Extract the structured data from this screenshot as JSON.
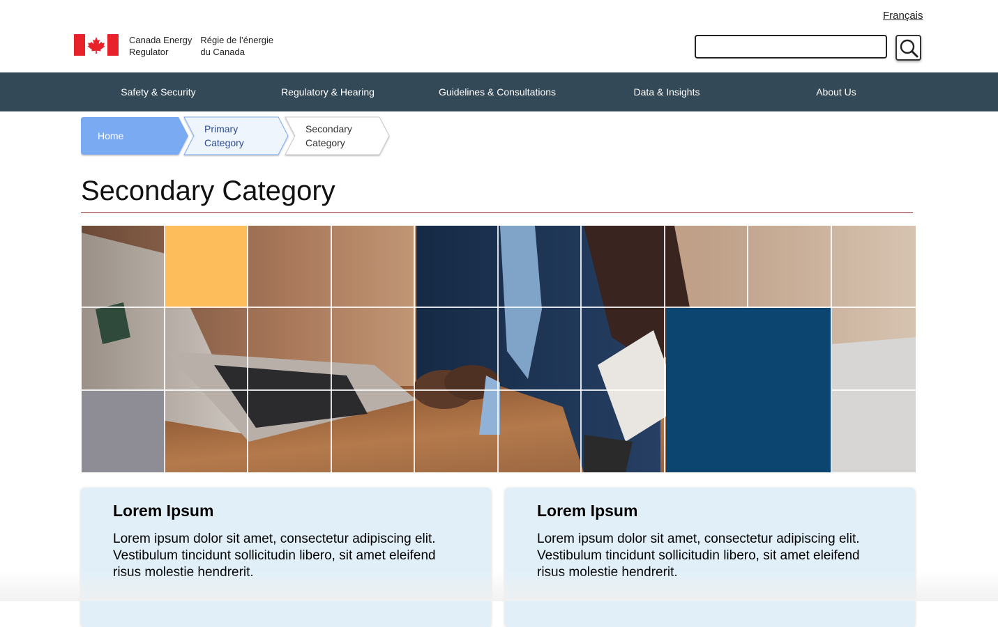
{
  "header": {
    "language_toggle": "Français",
    "wordmark_en": [
      "Canada Energy",
      "Regulator"
    ],
    "wordmark_fr": [
      "Régie de l’énergie",
      "du Canada"
    ],
    "search_placeholder": ""
  },
  "nav": {
    "items": [
      {
        "label": "Safety & Security"
      },
      {
        "label": "Regulatory & Hearing"
      },
      {
        "label": "Guidelines & Consultations"
      },
      {
        "label": "Data & Insights"
      },
      {
        "label": "About Us"
      }
    ]
  },
  "breadcrumb": {
    "items": [
      {
        "line1": "Home",
        "line2": ""
      },
      {
        "line1": "Primary",
        "line2": "Category"
      },
      {
        "line1": "Secondary",
        "line2": "Category"
      }
    ]
  },
  "page": {
    "title": "Secondary Category"
  },
  "cards": [
    {
      "title": "Lorem Ipsum",
      "body": "Lorem ipsum dolor sit amet, consectetur adipiscing elit. Vestibulum tincidunt sollicitudin libero, sit amet eleifend risus molestie hendrerit."
    },
    {
      "title": "Lorem Ipsum",
      "body": "Lorem ipsum dolor sit amet, consectetur adipiscing elit. Vestibulum tincidunt sollicitudin libero, sit amet eleifend risus molestie hendrerit."
    }
  ],
  "colors": {
    "nav_bg": "#344957",
    "crumb_home": "#7aabf2",
    "crumb_primary": "#eef5fd",
    "title_rule": "#8a1c22",
    "tile_yellow": "#fdbd5a",
    "tile_navy": "#0b4570",
    "tile_gray": "#8e8d96",
    "card_bg": "#e1f0f8"
  },
  "icons": [
    "canada-flag-icon",
    "search-icon",
    "breadcrumb-chevron"
  ]
}
